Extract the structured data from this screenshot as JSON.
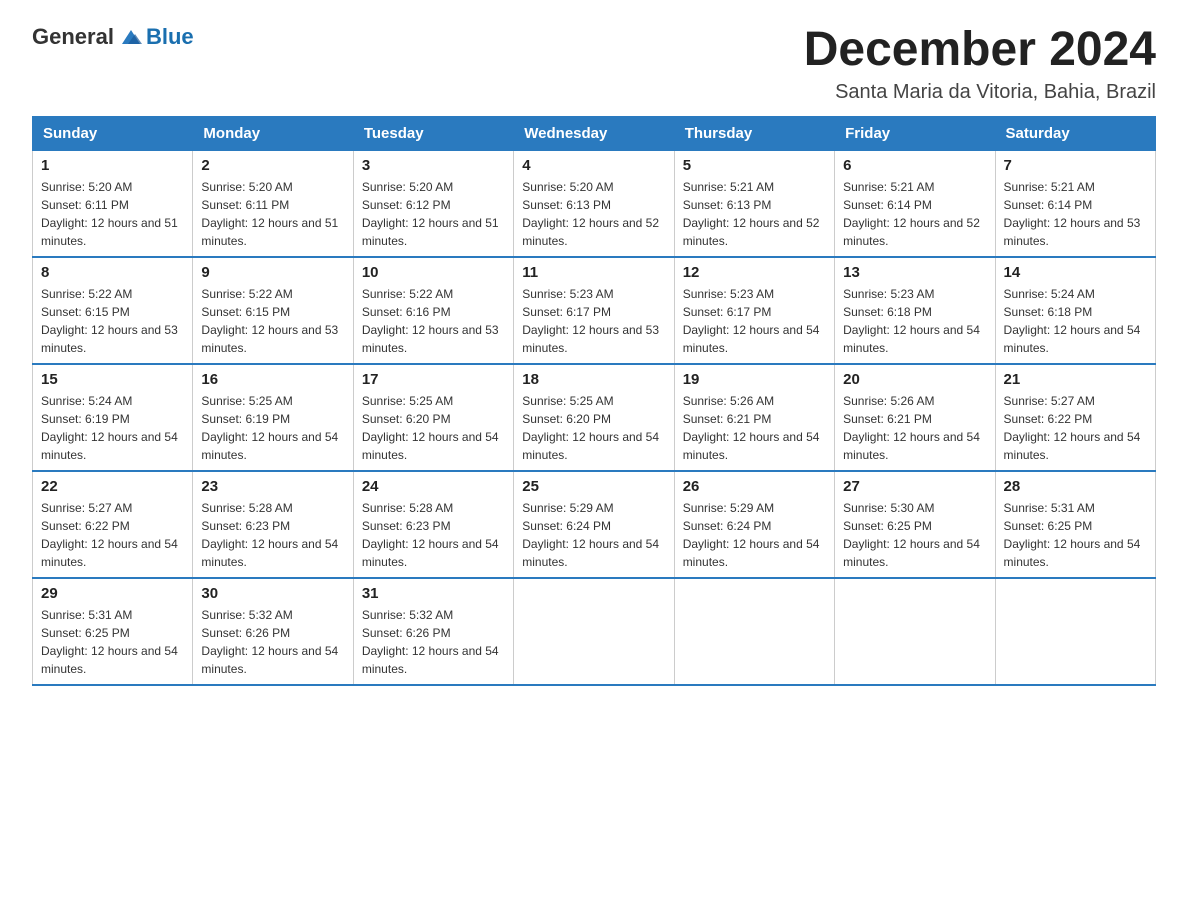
{
  "logo": {
    "general": "General",
    "blue": "Blue"
  },
  "title": "December 2024",
  "location": "Santa Maria da Vitoria, Bahia, Brazil",
  "days_of_week": [
    "Sunday",
    "Monday",
    "Tuesday",
    "Wednesday",
    "Thursday",
    "Friday",
    "Saturday"
  ],
  "weeks": [
    [
      {
        "day": "1",
        "sunrise": "5:20 AM",
        "sunset": "6:11 PM",
        "daylight": "12 hours and 51 minutes."
      },
      {
        "day": "2",
        "sunrise": "5:20 AM",
        "sunset": "6:11 PM",
        "daylight": "12 hours and 51 minutes."
      },
      {
        "day": "3",
        "sunrise": "5:20 AM",
        "sunset": "6:12 PM",
        "daylight": "12 hours and 51 minutes."
      },
      {
        "day": "4",
        "sunrise": "5:20 AM",
        "sunset": "6:13 PM",
        "daylight": "12 hours and 52 minutes."
      },
      {
        "day": "5",
        "sunrise": "5:21 AM",
        "sunset": "6:13 PM",
        "daylight": "12 hours and 52 minutes."
      },
      {
        "day": "6",
        "sunrise": "5:21 AM",
        "sunset": "6:14 PM",
        "daylight": "12 hours and 52 minutes."
      },
      {
        "day": "7",
        "sunrise": "5:21 AM",
        "sunset": "6:14 PM",
        "daylight": "12 hours and 53 minutes."
      }
    ],
    [
      {
        "day": "8",
        "sunrise": "5:22 AM",
        "sunset": "6:15 PM",
        "daylight": "12 hours and 53 minutes."
      },
      {
        "day": "9",
        "sunrise": "5:22 AM",
        "sunset": "6:15 PM",
        "daylight": "12 hours and 53 minutes."
      },
      {
        "day": "10",
        "sunrise": "5:22 AM",
        "sunset": "6:16 PM",
        "daylight": "12 hours and 53 minutes."
      },
      {
        "day": "11",
        "sunrise": "5:23 AM",
        "sunset": "6:17 PM",
        "daylight": "12 hours and 53 minutes."
      },
      {
        "day": "12",
        "sunrise": "5:23 AM",
        "sunset": "6:17 PM",
        "daylight": "12 hours and 54 minutes."
      },
      {
        "day": "13",
        "sunrise": "5:23 AM",
        "sunset": "6:18 PM",
        "daylight": "12 hours and 54 minutes."
      },
      {
        "day": "14",
        "sunrise": "5:24 AM",
        "sunset": "6:18 PM",
        "daylight": "12 hours and 54 minutes."
      }
    ],
    [
      {
        "day": "15",
        "sunrise": "5:24 AM",
        "sunset": "6:19 PM",
        "daylight": "12 hours and 54 minutes."
      },
      {
        "day": "16",
        "sunrise": "5:25 AM",
        "sunset": "6:19 PM",
        "daylight": "12 hours and 54 minutes."
      },
      {
        "day": "17",
        "sunrise": "5:25 AM",
        "sunset": "6:20 PM",
        "daylight": "12 hours and 54 minutes."
      },
      {
        "day": "18",
        "sunrise": "5:25 AM",
        "sunset": "6:20 PM",
        "daylight": "12 hours and 54 minutes."
      },
      {
        "day": "19",
        "sunrise": "5:26 AM",
        "sunset": "6:21 PM",
        "daylight": "12 hours and 54 minutes."
      },
      {
        "day": "20",
        "sunrise": "5:26 AM",
        "sunset": "6:21 PM",
        "daylight": "12 hours and 54 minutes."
      },
      {
        "day": "21",
        "sunrise": "5:27 AM",
        "sunset": "6:22 PM",
        "daylight": "12 hours and 54 minutes."
      }
    ],
    [
      {
        "day": "22",
        "sunrise": "5:27 AM",
        "sunset": "6:22 PM",
        "daylight": "12 hours and 54 minutes."
      },
      {
        "day": "23",
        "sunrise": "5:28 AM",
        "sunset": "6:23 PM",
        "daylight": "12 hours and 54 minutes."
      },
      {
        "day": "24",
        "sunrise": "5:28 AM",
        "sunset": "6:23 PM",
        "daylight": "12 hours and 54 minutes."
      },
      {
        "day": "25",
        "sunrise": "5:29 AM",
        "sunset": "6:24 PM",
        "daylight": "12 hours and 54 minutes."
      },
      {
        "day": "26",
        "sunrise": "5:29 AM",
        "sunset": "6:24 PM",
        "daylight": "12 hours and 54 minutes."
      },
      {
        "day": "27",
        "sunrise": "5:30 AM",
        "sunset": "6:25 PM",
        "daylight": "12 hours and 54 minutes."
      },
      {
        "day": "28",
        "sunrise": "5:31 AM",
        "sunset": "6:25 PM",
        "daylight": "12 hours and 54 minutes."
      }
    ],
    [
      {
        "day": "29",
        "sunrise": "5:31 AM",
        "sunset": "6:25 PM",
        "daylight": "12 hours and 54 minutes."
      },
      {
        "day": "30",
        "sunrise": "5:32 AM",
        "sunset": "6:26 PM",
        "daylight": "12 hours and 54 minutes."
      },
      {
        "day": "31",
        "sunrise": "5:32 AM",
        "sunset": "6:26 PM",
        "daylight": "12 hours and 54 minutes."
      },
      null,
      null,
      null,
      null
    ]
  ]
}
